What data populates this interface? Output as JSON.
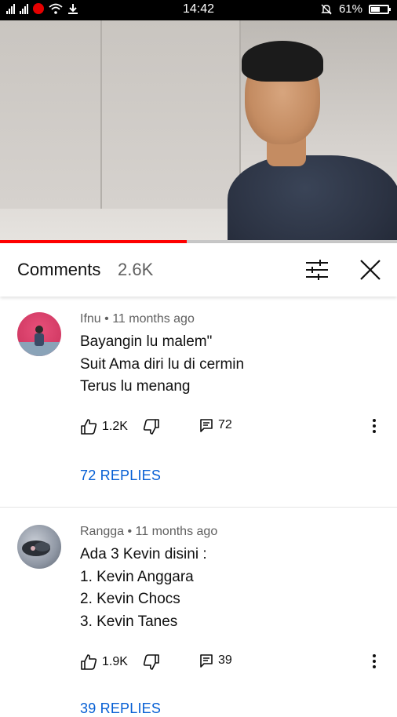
{
  "status_bar": {
    "time": "14:42",
    "battery": "61%",
    "battery_level": 0.61
  },
  "video": {
    "progress": 0.47
  },
  "header": {
    "title": "Comments",
    "count": "2.6K"
  },
  "comments": [
    {
      "author": "Ifnu",
      "time": "11 months ago",
      "lines": [
        "Bayangin lu malem\"",
        "Suit Ama diri lu di cermin",
        "Terus lu menang"
      ],
      "likes": "1.2K",
      "reply_count": "72",
      "replies_link": "72 REPLIES"
    },
    {
      "author": "Rangga",
      "time": "11 months ago",
      "lines": [
        "Ada 3 Kevin disini :",
        "1. Kevin Anggara",
        "2. Kevin Chocs",
        "3. Kevin Tanes"
      ],
      "likes": "1.9K",
      "reply_count": "39",
      "replies_link": "39 REPLIES"
    }
  ],
  "colors": {
    "accent_link": "#065fd4",
    "progress": "#ff0000"
  },
  "icons": [
    "signal-icon",
    "wifi-icon",
    "download-icon",
    "mute-icon",
    "battery-icon",
    "filter-icon",
    "close-icon",
    "like-icon",
    "dislike-icon",
    "reply-icon",
    "more-icon"
  ]
}
